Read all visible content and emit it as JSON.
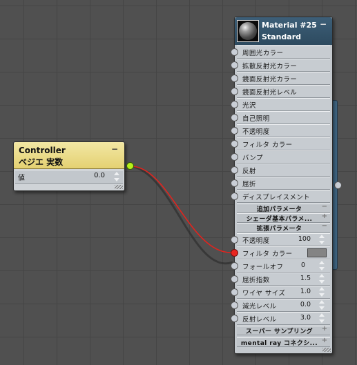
{
  "controller": {
    "title_line1": "Controller",
    "title_line2": "ベジエ 実数",
    "minimize": "−",
    "param_label": "値",
    "param_value": "0.0"
  },
  "material": {
    "title_line1": "Material #25",
    "title_line2": "Standard",
    "minimize": "−",
    "slots": [
      "周囲光カラー",
      "拡散反射光カラー",
      "鏡面反射光カラー",
      "鏡面反射光レベル",
      "光沢",
      "自己照明",
      "不透明度",
      "フィルタ カラー",
      "バンプ",
      "反射",
      "屈折",
      "ディスプレイスメント"
    ],
    "sections": {
      "extra": {
        "label": "追加パラメータ",
        "toggle": "−"
      },
      "shader": {
        "label": "シェーダ基本パラメ...",
        "toggle": "+"
      },
      "extended": {
        "label": "拡張パラメータ",
        "toggle": "−"
      },
      "supersampling": {
        "label": "スーパー サンプリング",
        "toggle": "+"
      },
      "mentalray": {
        "label": "mental ray コネクシ...",
        "toggle": "+"
      }
    },
    "extended_params": [
      {
        "label": "不透明度",
        "value": "100"
      },
      {
        "label": "フィルタ カラー",
        "value": ""
      },
      {
        "label": "フォールオフ",
        "value": "0"
      },
      {
        "label": "屈折指数",
        "value": "1.5"
      },
      {
        "label": "ワイヤ サイズ",
        "value": "1.0"
      },
      {
        "label": "減光レベル",
        "value": "0.0"
      },
      {
        "label": "反射レベル",
        "value": "3.0"
      }
    ]
  },
  "colors": {
    "wire_active": "#e3231d",
    "wire_shadow": "#2e2e2e",
    "controller_header": "#e8d77c",
    "material_header": "#355670",
    "filter_swatch": "#848484"
  }
}
